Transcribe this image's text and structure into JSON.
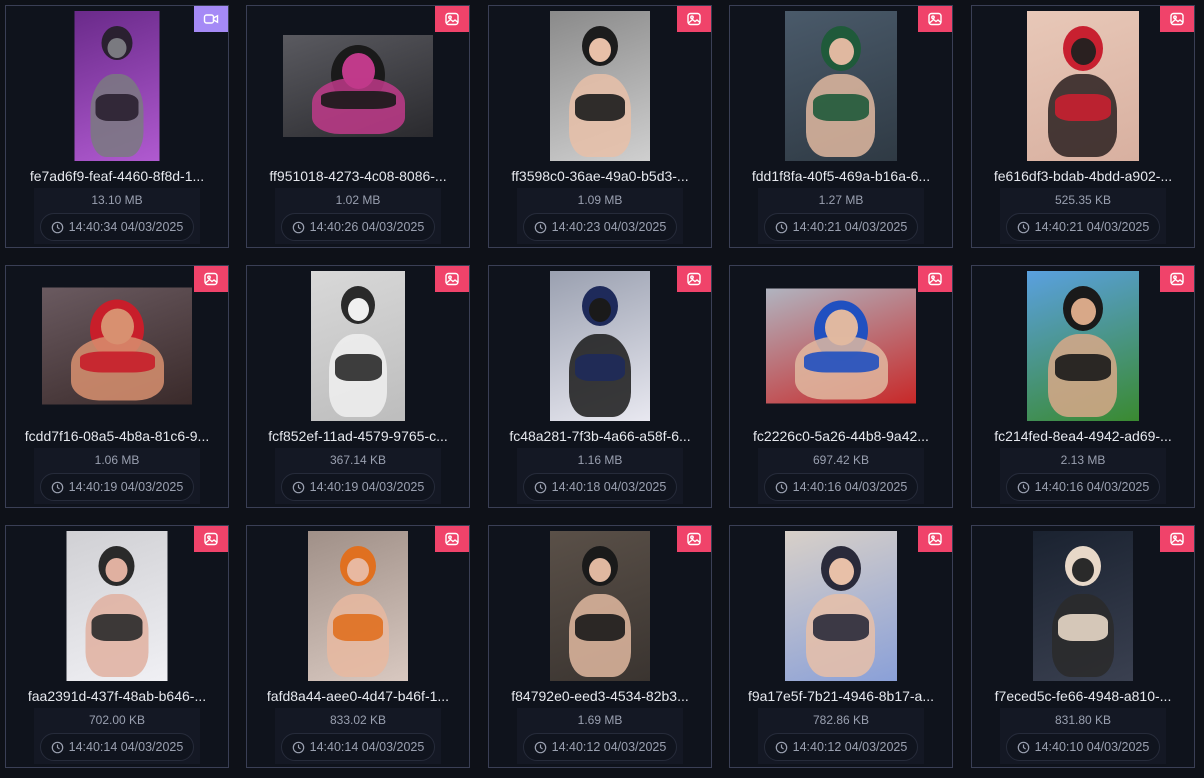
{
  "items": [
    {
      "name": "fe7ad6f9-feaf-4460-8f8d-1...",
      "size": "13.10 MB",
      "time": "14:40:34 04/03/2025",
      "type": "video",
      "colors": [
        "#6a2a8a",
        "#b05ad0",
        "#2a2030",
        "#7a7a80"
      ]
    },
    {
      "name": "ff951018-4273-4c08-8086-...",
      "size": "1.02 MB",
      "time": "14:40:26 04/03/2025",
      "type": "image",
      "colors": [
        "#5a5a60",
        "#2a2a2e",
        "#1a1a1a",
        "#c03a8a"
      ]
    },
    {
      "name": "ff3598c0-36ae-49a0-b5d3-...",
      "size": "1.09 MB",
      "time": "14:40:23 04/03/2025",
      "type": "image",
      "colors": [
        "#8a8a8a",
        "#cfcfcf",
        "#1c1c1c",
        "#e8c0a8"
      ]
    },
    {
      "name": "fdd1f8fa-40f5-469a-b16a-6...",
      "size": "1.27 MB",
      "time": "14:40:21 04/03/2025",
      "type": "image",
      "colors": [
        "#4a5a6a",
        "#2f3a44",
        "#1f5a3a",
        "#e0b8a0"
      ]
    },
    {
      "name": "fe616df3-bdab-4bdd-a902-...",
      "size": "525.35 KB",
      "time": "14:40:21 04/03/2025",
      "type": "image",
      "colors": [
        "#e8c8b8",
        "#d8b0a0",
        "#c82030",
        "#2a2020"
      ]
    },
    {
      "name": "fcdd7f16-08a5-4b8a-81c6-9...",
      "size": "1.06 MB",
      "time": "14:40:19 04/03/2025",
      "type": "image",
      "colors": [
        "#6a5a60",
        "#3a2a2a",
        "#c81e2a",
        "#d89070"
      ]
    },
    {
      "name": "fcf852ef-11ad-4579-9765-c...",
      "size": "367.14 KB",
      "time": "14:40:19 04/03/2025",
      "type": "image",
      "colors": [
        "#d8d8d8",
        "#bdbdbd",
        "#2a2a2a",
        "#f0f0f0"
      ]
    },
    {
      "name": "fc48a281-7f3b-4a66-a58f-6...",
      "size": "1.16 MB",
      "time": "14:40:18 04/03/2025",
      "type": "image",
      "colors": [
        "#9aa0b0",
        "#e8e8f0",
        "#1e2a5a",
        "#1a1a1a"
      ]
    },
    {
      "name": "fc2226c0-5a26-44b8-9a42...",
      "size": "697.42 KB",
      "time": "14:40:16 04/03/2025",
      "type": "image",
      "colors": [
        "#b0b4c0",
        "#c82828",
        "#2050c0",
        "#e0b8a0"
      ]
    },
    {
      "name": "fc214fed-8ea4-4942-ad69-...",
      "size": "2.13 MB",
      "time": "14:40:16 04/03/2025",
      "type": "image",
      "colors": [
        "#5aa0e0",
        "#3a8a30",
        "#1a1a1a",
        "#d8a888"
      ]
    },
    {
      "name": "faa2391d-437f-48ab-b646-...",
      "size": "702.00 KB",
      "time": "14:40:14 04/03/2025",
      "type": "image",
      "colors": [
        "#d0d0d4",
        "#f0f0f4",
        "#2a2a2a",
        "#e0b0a0"
      ]
    },
    {
      "name": "fafd8a44-aee0-4d47-b46f-1...",
      "size": "833.02 KB",
      "time": "14:40:14 04/03/2025",
      "type": "image",
      "colors": [
        "#a09088",
        "#d8c8c0",
        "#e07020",
        "#e8b8a0"
      ]
    },
    {
      "name": "f84792e0-eed3-4534-82b3...",
      "size": "1.69 MB",
      "time": "14:40:12 04/03/2025",
      "type": "image",
      "colors": [
        "#5a5048",
        "#3a3430",
        "#1a1a1a",
        "#e0b8a0"
      ]
    },
    {
      "name": "f9a17e5f-7b21-4946-8b17-a...",
      "size": "782.86 KB",
      "time": "14:40:12 04/03/2025",
      "type": "image",
      "colors": [
        "#d8d0c8",
        "#8aa0d8",
        "#2a2a3a",
        "#e8c0a8"
      ]
    },
    {
      "name": "f7eced5c-fe66-4948-a810-...",
      "size": "831.80 KB",
      "time": "14:40:10 04/03/2025",
      "type": "image",
      "colors": [
        "#1a2230",
        "#3a4050",
        "#e8d8c8",
        "#2a2a2a"
      ]
    }
  ]
}
